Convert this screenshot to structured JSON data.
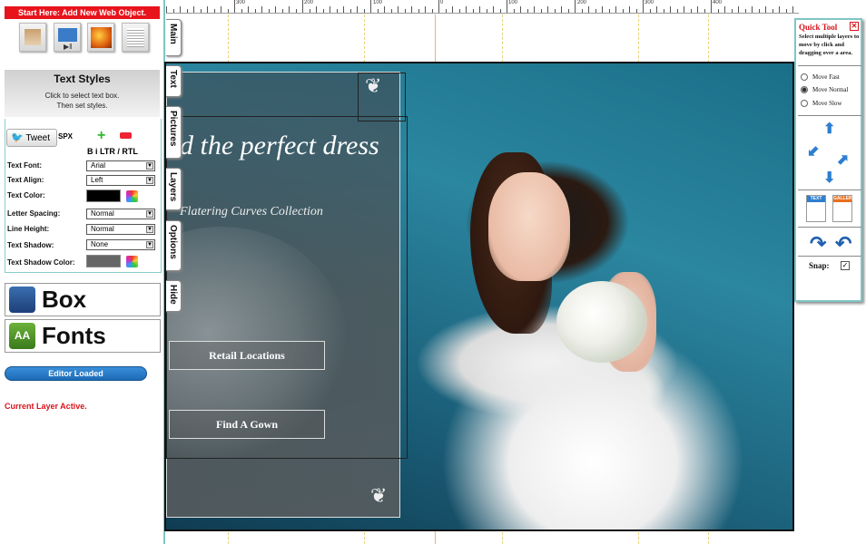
{
  "left_panel": {
    "add_header": "Start Here: Add New Web Object.",
    "object_icons": [
      "text-object-icon",
      "video-object-icon",
      "image-object-icon",
      "form-object-icon"
    ],
    "text_styles": {
      "title": "Text Styles",
      "hint_line1": "Click to select text box.",
      "hint_line2": "Then set styles."
    },
    "tweet_label": "Tweet",
    "size_suffix": "SPX",
    "format_labels": "B i LTR / RTL",
    "fields": {
      "text_font": {
        "label": "Text Font:",
        "value": "Arial"
      },
      "text_align": {
        "label": "Text Align:",
        "value": "Left"
      },
      "text_color": {
        "label": "Text Color:",
        "value": "#000000"
      },
      "letter_spacing": {
        "label": "Letter Spacing:",
        "value": "Normal"
      },
      "line_height": {
        "label": "Line Height:",
        "value": "Normal"
      },
      "text_shadow": {
        "label": "Text Shadow:",
        "value": "None"
      },
      "text_shadow_color": {
        "label": "Text Shadow Color:",
        "value": "#666666"
      }
    },
    "box_button": "Box",
    "fonts_button": "Fonts",
    "fonts_icon_text": "AA",
    "status_pill": "Editor Loaded",
    "layer_status": "Current Layer Active."
  },
  "ruler": {
    "labels": [
      "300",
      "200",
      "100",
      "0",
      "100",
      "200",
      "300",
      "400"
    ]
  },
  "side_tabs": [
    "Main",
    "Text",
    "Pictures",
    "Layers",
    "Options",
    "Hide"
  ],
  "canvas": {
    "headline": "d the perfect dress",
    "subline": "Flatering Curves Collection",
    "button_retail": "Retail Locations",
    "button_gown": "Find A Gown"
  },
  "quick_tool": {
    "title": "Quick Tool",
    "close": "✕",
    "description": "Select multiple layers to move by click and dragging over a area.",
    "options": [
      {
        "label": "Move Fast",
        "selected": false
      },
      {
        "label": "Move Normal",
        "selected": true
      },
      {
        "label": "Move Slow",
        "selected": false
      }
    ],
    "tile_text": "TEXT",
    "tile_gallery": "GALLERY",
    "snap_label": "Snap:",
    "snap_checked": "✓"
  },
  "colors": {
    "accent_red": "#e8141c",
    "panel_border": "#7fc6c6",
    "pill_blue": "#1c6bb8"
  }
}
